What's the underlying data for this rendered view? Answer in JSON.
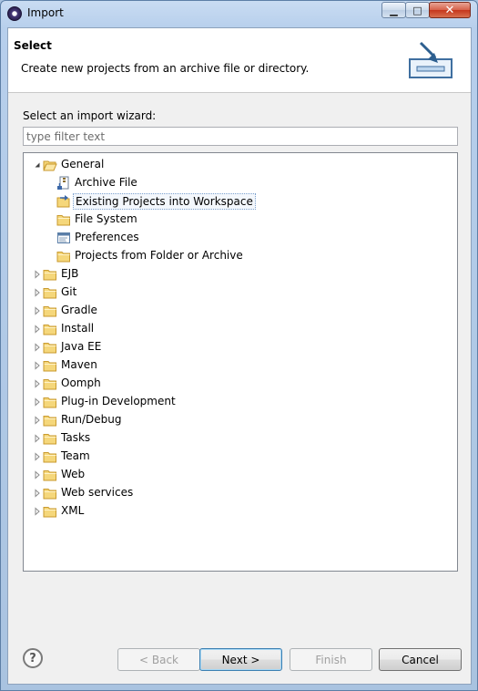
{
  "window": {
    "title": "Import",
    "minimize_glyph": "▁",
    "maximize_glyph": "□",
    "close_glyph": "✕"
  },
  "banner": {
    "title": "Select",
    "description": "Create new projects from an archive file or directory."
  },
  "filter": {
    "label": "Select an import wizard:",
    "placeholder": "type filter text",
    "value": ""
  },
  "tree": {
    "items": [
      {
        "label": "General",
        "expanded": true,
        "level": 0,
        "icon": "folder-open-icon"
      },
      {
        "label": "Archive File",
        "level": 1,
        "icon": "archive-file-icon"
      },
      {
        "label": "Existing Projects into Workspace",
        "level": 1,
        "icon": "existing-projects-icon",
        "selected": true
      },
      {
        "label": "File System",
        "level": 1,
        "icon": "folder-icon"
      },
      {
        "label": "Preferences",
        "level": 1,
        "icon": "preferences-icon"
      },
      {
        "label": "Projects from Folder or Archive",
        "level": 1,
        "icon": "folder-icon"
      },
      {
        "label": "EJB",
        "level": 0,
        "icon": "folder-icon"
      },
      {
        "label": "Git",
        "level": 0,
        "icon": "folder-icon"
      },
      {
        "label": "Gradle",
        "level": 0,
        "icon": "folder-icon"
      },
      {
        "label": "Install",
        "level": 0,
        "icon": "folder-icon"
      },
      {
        "label": "Java EE",
        "level": 0,
        "icon": "folder-icon"
      },
      {
        "label": "Maven",
        "level": 0,
        "icon": "folder-icon"
      },
      {
        "label": "Oomph",
        "level": 0,
        "icon": "folder-icon"
      },
      {
        "label": "Plug-in Development",
        "level": 0,
        "icon": "folder-icon"
      },
      {
        "label": "Run/Debug",
        "level": 0,
        "icon": "folder-icon"
      },
      {
        "label": "Tasks",
        "level": 0,
        "icon": "folder-icon"
      },
      {
        "label": "Team",
        "level": 0,
        "icon": "folder-icon"
      },
      {
        "label": "Web",
        "level": 0,
        "icon": "folder-icon"
      },
      {
        "label": "Web services",
        "level": 0,
        "icon": "folder-icon"
      },
      {
        "label": "XML",
        "level": 0,
        "icon": "folder-icon"
      }
    ]
  },
  "buttons": {
    "help": "?",
    "back": "< Back",
    "next": "Next >",
    "finish": "Finish",
    "cancel": "Cancel"
  },
  "colors": {
    "folder": "#f5d77b",
    "folder_border": "#c99a2e",
    "accent": "#3c7fb1"
  }
}
